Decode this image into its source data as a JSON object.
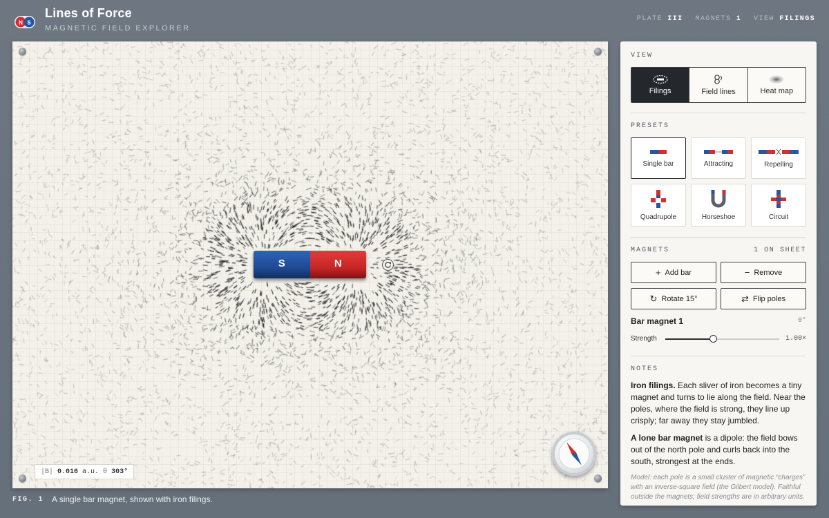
{
  "header": {
    "title": "Lines of Force",
    "subtitle": "MAGNETIC FIELD EXPLORER",
    "logo_letters": [
      "N",
      "S"
    ],
    "meta": [
      {
        "label": "PLATE",
        "value": "III"
      },
      {
        "label": "MAGNETS",
        "value": "1"
      },
      {
        "label": "VIEW",
        "value": "FILINGS"
      }
    ]
  },
  "sheet": {
    "magnet": {
      "south_label": "S",
      "north_label": "N"
    },
    "readout": {
      "b_label": "|B|",
      "b_value": "0.016",
      "b_unit": "a.u.",
      "theta_label": "θ",
      "theta_value": "303°"
    },
    "caption": {
      "fig": "FIG. 1",
      "text": "A single bar magnet, shown with iron filings."
    }
  },
  "panel": {
    "view": {
      "label": "VIEW",
      "options": [
        {
          "label": "Filings",
          "icon": "filings-icon",
          "active": true
        },
        {
          "label": "Field lines",
          "icon": "field-lines-icon",
          "active": false
        },
        {
          "label": "Heat map",
          "icon": "heat-map-icon",
          "active": false
        }
      ]
    },
    "presets": {
      "label": "PRESETS",
      "items": [
        {
          "label": "Single bar",
          "active": true
        },
        {
          "label": "Attracting",
          "active": false
        },
        {
          "label": "Repelling",
          "active": false
        },
        {
          "label": "Quadrupole",
          "active": false
        },
        {
          "label": "Horseshoe",
          "active": false
        },
        {
          "label": "Circuit",
          "active": false
        }
      ]
    },
    "magnets": {
      "label": "MAGNETS",
      "count": "1 ON SHEET",
      "add_label": "Add bar",
      "remove_label": "Remove",
      "rotate_label": "Rotate 15°",
      "flip_label": "Flip poles",
      "selected": {
        "name": "Bar magnet 1",
        "angle": "0°",
        "strength_label": "Strength",
        "strength_value": "1.00×",
        "strength_fraction": 0.42
      }
    },
    "notes": {
      "label": "NOTES",
      "p1_bold": "Iron filings.",
      "p1_text": " Each sliver of iron becomes a tiny magnet and turns to lie along the field. Near the poles, where the field is strong, they line up crisply; far away they stay jumbled.",
      "p2_bold": "A lone bar magnet",
      "p2_text": " is a dipole: the field bows out of the north pole and curls back into the south, strongest at the ends.",
      "model": "Model: each pole is a small cluster of magnetic “charges” with an inverse-square field (the Gilbert model). Faithful outside the magnets; field strengths are in arbitrary units."
    }
  },
  "colors": {
    "north": "#d32f2f",
    "south": "#2456a6",
    "dark": "#24272c",
    "paper": "#f3f1ea"
  }
}
